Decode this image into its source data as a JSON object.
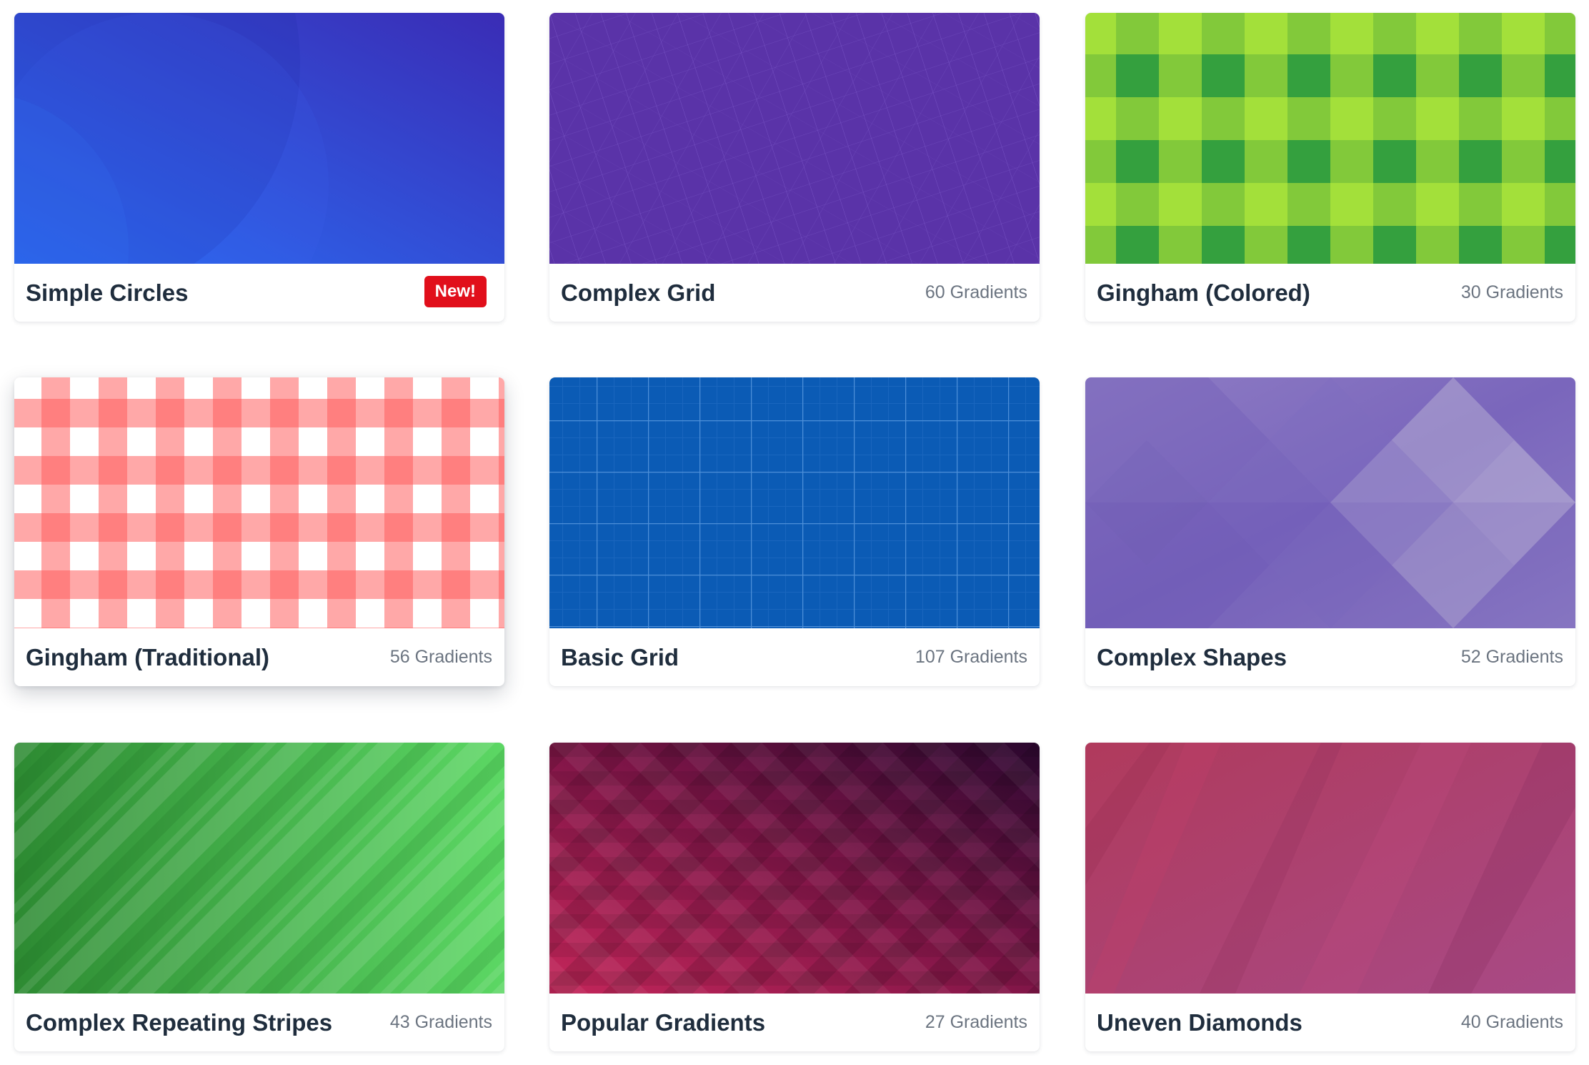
{
  "cards": [
    {
      "title": "Simple Circles",
      "badge": "New!",
      "colors": [
        "#2a5cf0",
        "#3a2fb8"
      ]
    },
    {
      "title": "Complex Grid",
      "count": "60 Gradients",
      "colors": [
        "#5a33a8"
      ]
    },
    {
      "title": "Gingham (Colored)",
      "count": "30 Gradients",
      "colors": [
        "#a3e03a",
        "#82c93a",
        "#34a03e"
      ]
    },
    {
      "title": "Gingham (Traditional)",
      "count": "56 Gradients",
      "colors": [
        "#ffffff",
        "#ffa8a8",
        "#ff7f7f"
      ]
    },
    {
      "title": "Basic Grid",
      "count": "107 Gradients",
      "colors": [
        "#0b5bb5"
      ]
    },
    {
      "title": "Complex Shapes",
      "count": "52 Gradients",
      "colors": [
        "#9384c6",
        "#6d56b4"
      ]
    },
    {
      "title": "Complex Repeating Stripes",
      "count": "43 Gradients",
      "colors": [
        "#2d8a32",
        "#6bdc6a"
      ]
    },
    {
      "title": "Popular Gradients",
      "count": "27 Gradients",
      "colors": [
        "#b0204f",
        "#3a0a36"
      ]
    },
    {
      "title": "Uneven Diamonds",
      "count": "40 Gradients",
      "colors": [
        "#b03a5c",
        "#a84a86"
      ]
    }
  ]
}
